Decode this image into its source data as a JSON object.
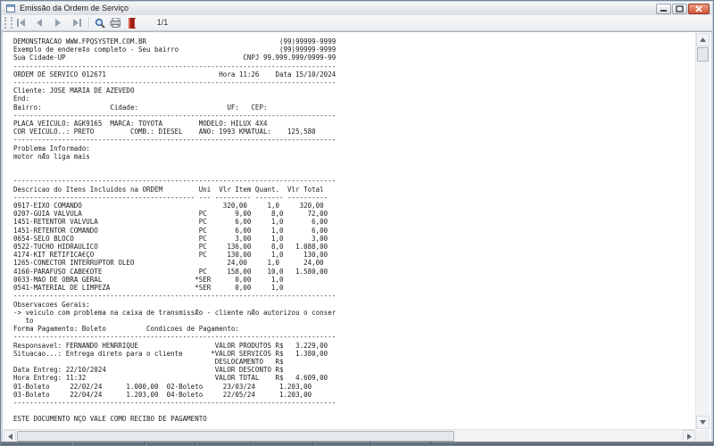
{
  "window": {
    "title": "Emissão da Ordem de Serviço",
    "controls": {
      "minimize": "minimize",
      "maximize": "maximize",
      "close": "close"
    }
  },
  "toolbar": {
    "page_indicator": "1/1",
    "buttons": [
      "first-page",
      "previous-page",
      "next-page",
      "last-page",
      "zoom",
      "print",
      "exit"
    ]
  },
  "colors": {
    "close_button": "#d05535",
    "titlebar_bg": "#e8ebee",
    "toolbar_bg": "#f1f2f4",
    "report_text": "#1b1b1b",
    "page_bg": "#ffffff",
    "magnifier_blue": "#3465a4",
    "exit_red": "#9e1b12"
  },
  "report": {
    "lines": [
      "DEMONSTRACAO WWW.FPQSYSTEM.COM.BR                                 (99)99999-9999",
      "Exemplo de endere‡o completo - Seu bairro                         (99)99999-9999",
      "Sua Cidade-UP                                            CNPJ 99.999.999/9999-99",
      "--------------------------------------------------------------------------------",
      "ORDEM DE SERVICO 012671                            Hora 11:26    Data 15/10/2024",
      "--------------------------------------------------------------------------------",
      "Cliente: JOSE MARIA DE AZEVEDO",
      "End:",
      "Bairro:                 Cidade:                      UF:   CEP:",
      "--------------------------------------------------------------------------------",
      "PLACA VEICULO: AGK9165  MARCA: TOYOTA         MODELO: HILUX 4X4",
      "COR VEICULO..: PRETO         COMB.: DIESEL    ANO: 1993 KMATUAL:    125,580",
      "--------------------------------------------------------------------------------",
      "Problema Informado:",
      "motor nÆo liga mais",
      "",
      "",
      "--------------------------------------------------------------------------------",
      "Descricao do Itens Incluidos na ORDEM         Uni  Vlr Item Quant.  Vlr Total",
      "--------------------------------------------- --- --------- ------- ----------",
      "0917-EIXO COMANDO                                   320,00     1,0     320,00",
      "0207-GUIA VALVULA                             PC       9,00     8,0      72,00",
      "1451-RETENTOR VALVULA                         PC       6,00     1,0       6,00",
      "1451-RETENTOR COMANDO                         PC       6,00     1,0       6,00",
      "0654-SELO BLOCO                               PC       3,00     1,0       3,00",
      "0522-TUCHO HIDRAULICO                         PC     136,00     8,0   1.088,00",
      "4174-KIT RETIFICA€ÇO                          PC     130,00     1,0     130,00",
      "1265-CONECTOR INTERRUPTOR OLEO                       24,00     1,0      24,00",
      "4160-PARAFUSO CABE€OTE                        PC     158,00    10,0   1.580,00",
      "0033-MAO DE OBRA GERAL                       *SER      0,00     1,0",
      "0541-MATERIAL DE LIMPEZA                     *SER      0,00     1,0",
      "--------------------------------------------------------------------------------",
      "Observacoes Gerais:",
      "-> veiculo com problema na caixa de transmissÆo - cliente nÆo autorizou o conser",
      "   to",
      "Forma Pagamento: Boleto          Condicoes de Pagamento:",
      "--------------------------------------------------------------------------------",
      "Responsavel: FERNANDO HENRRIQUE                   VALOR PRODUTOS R$   3.229,00",
      "Situacao...: Entrega direto para o cliente       *VALOR SERVICOS R$   1.380,00",
      "                                                  DESLOCAMENTO   R$",
      "Data Entreg: 22/10/2024                           VALOR DESCONTO R$",
      "Hora Entreg: 11:32                                VALOR TOTAL    R$   4.609,00",
      "01-Boleto     22/02/24      1.000,00  02-Boleto     23/03/24      1.203,00",
      "03-Boleto     22/04/24      1.203,00  04-Boleto     22/05/24      1.203,00",
      "--------------------------------------------------------------------------------",
      "",
      "ESTE DOCUMENTO NÇO VALE COMO RECIBO DE PAGAMENTO"
    ]
  }
}
